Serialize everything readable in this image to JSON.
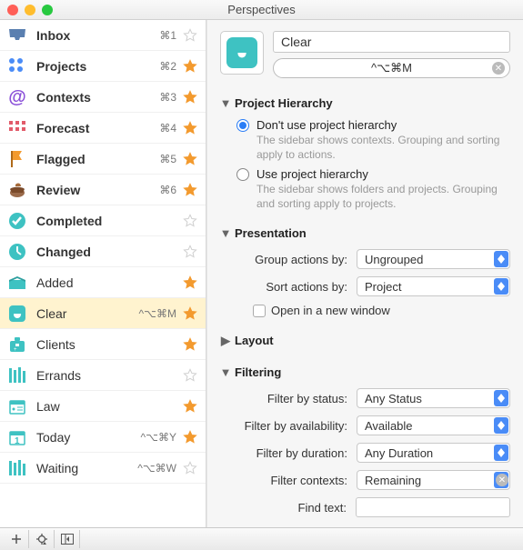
{
  "window": {
    "title": "Perspectives"
  },
  "sidebar": {
    "items": [
      {
        "label": "Inbox",
        "shortcut": "⌘1",
        "starred": false,
        "bold": true,
        "icon": "inbox"
      },
      {
        "label": "Projects",
        "shortcut": "⌘2",
        "starred": true,
        "bold": true,
        "icon": "projects"
      },
      {
        "label": "Contexts",
        "shortcut": "⌘3",
        "starred": true,
        "bold": true,
        "icon": "contexts"
      },
      {
        "label": "Forecast",
        "shortcut": "⌘4",
        "starred": true,
        "bold": true,
        "icon": "forecast"
      },
      {
        "label": "Flagged",
        "shortcut": "⌘5",
        "starred": true,
        "bold": true,
        "icon": "flagged"
      },
      {
        "label": "Review",
        "shortcut": "⌘6",
        "starred": true,
        "bold": true,
        "icon": "review"
      },
      {
        "label": "Completed",
        "shortcut": "",
        "starred": false,
        "bold": true,
        "icon": "completed"
      },
      {
        "label": "Changed",
        "shortcut": "",
        "starred": false,
        "bold": true,
        "icon": "changed"
      },
      {
        "label": "Added",
        "shortcut": "",
        "starred": true,
        "bold": false,
        "icon": "added"
      },
      {
        "label": "Clear",
        "shortcut": "^⌥⌘M",
        "starred": true,
        "bold": false,
        "icon": "clear",
        "selected": true
      },
      {
        "label": "Clients",
        "shortcut": "",
        "starred": true,
        "bold": false,
        "icon": "clients"
      },
      {
        "label": "Errands",
        "shortcut": "",
        "starred": false,
        "bold": false,
        "icon": "errands"
      },
      {
        "label": "Law",
        "shortcut": "",
        "starred": true,
        "bold": false,
        "icon": "law"
      },
      {
        "label": "Today",
        "shortcut": "^⌥⌘Y",
        "starred": true,
        "bold": false,
        "icon": "today"
      },
      {
        "label": "Waiting",
        "shortcut": "^⌥⌘W",
        "starred": false,
        "bold": false,
        "icon": "waiting"
      }
    ]
  },
  "editor": {
    "name": "Clear",
    "shortcut": "^⌥⌘M",
    "sections": {
      "hierarchy": {
        "title": "Project Hierarchy",
        "options": [
          {
            "label": "Don't use project hierarchy",
            "sub": "The sidebar shows contexts. Grouping and sorting apply to actions.",
            "checked": true
          },
          {
            "label": "Use project hierarchy",
            "sub": "The sidebar shows folders and projects. Grouping and sorting apply to projects.",
            "checked": false
          }
        ]
      },
      "presentation": {
        "title": "Presentation",
        "group_label": "Group actions by:",
        "group_value": "Ungrouped",
        "sort_label": "Sort actions by:",
        "sort_value": "Project",
        "newwindow_label": "Open in a new window",
        "newwindow_checked": false
      },
      "layout": {
        "title": "Layout"
      },
      "filtering": {
        "title": "Filtering",
        "rows": [
          {
            "label": "Filter by status:",
            "value": "Any Status"
          },
          {
            "label": "Filter by availability:",
            "value": "Available"
          },
          {
            "label": "Filter by duration:",
            "value": "Any Duration"
          },
          {
            "label": "Filter contexts:",
            "value": "Remaining"
          }
        ],
        "findtext_label": "Find text:",
        "findtext_value": ""
      }
    }
  },
  "colors": {
    "star_on": "#f39a2e",
    "star_off": "#cfcfcf",
    "accent_teal": "#3ec2c2"
  }
}
